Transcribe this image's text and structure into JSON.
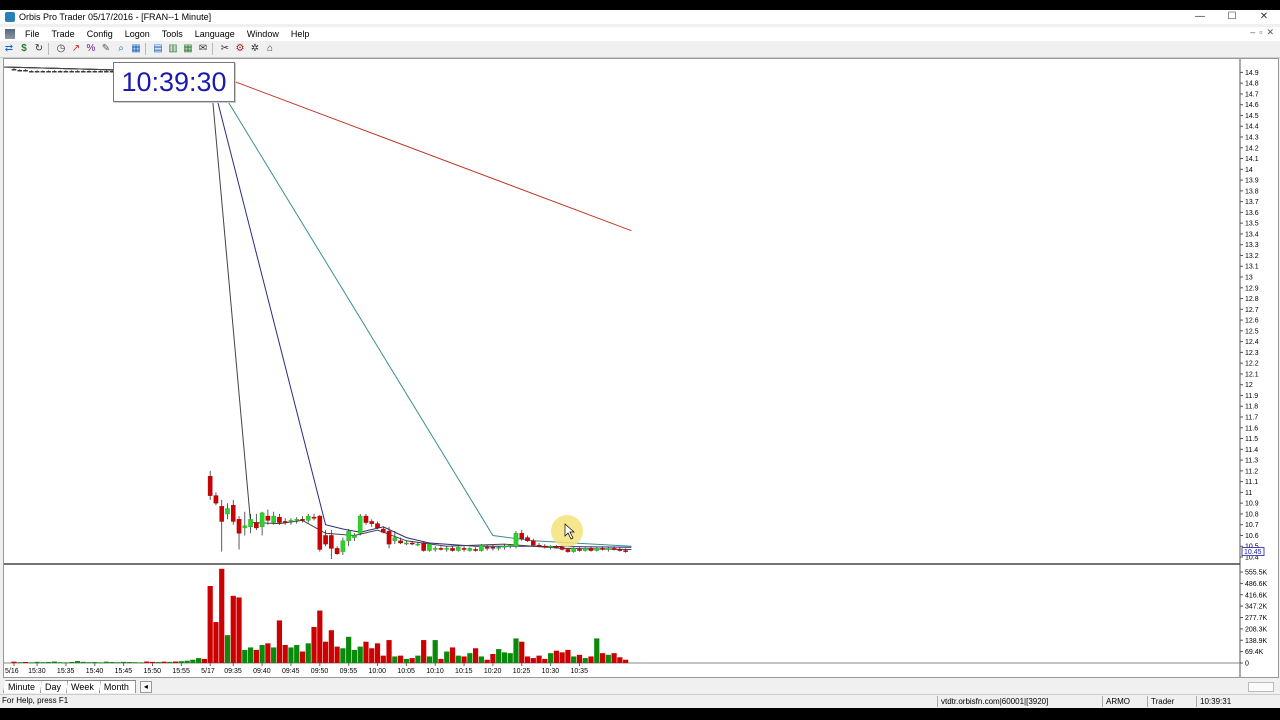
{
  "window": {
    "title": "Orbis Pro Trader  05/17/2016 - [FRAN--1 Minute]",
    "controls": [
      "—",
      "☐",
      "✕"
    ]
  },
  "menu": [
    "File",
    "Trade",
    "Config",
    "Logon",
    "Tools",
    "Language",
    "Window",
    "Help"
  ],
  "mdi_controls": [
    "–",
    "▫",
    "✕"
  ],
  "toolbar_icons": [
    "transfer-icon",
    "dollar-icon",
    "refresh-icon",
    "clock-icon",
    "draw-icon",
    "percent-icon",
    "pencil-icon",
    "zoom-icon",
    "grid-icon",
    "chart-icon",
    "chart-add-icon",
    "table-icon",
    "mail-icon",
    "tools-icon",
    "settings-icon",
    "gear-icon",
    "home-icon"
  ],
  "clock": "10:39:30",
  "tabs": [
    "Minute",
    "Day",
    "Week",
    "Month"
  ],
  "tab_nav": "◂",
  "status": {
    "help": "For Help, press F1",
    "server": "vtdtr.orbisfn.com|60001|[3920]",
    "account": "ARMO",
    "role": "Trader",
    "time": "10:39:31"
  },
  "colors": {
    "up": "#2ed12e",
    "down": "#cc0000",
    "vol_up": "#0a8a0a",
    "vol_down": "#cc0000",
    "ma_red": "#c0392b",
    "ma_teal": "#3a8f8f",
    "ma_navy": "#2b2b80",
    "ma_dark": "#444444",
    "clock_text": "#1a1ab0"
  },
  "chart_data": {
    "type": "candlestick",
    "symbol": "FRAN",
    "interval": "1 Minute",
    "price_ylim": [
      10.4,
      14.95
    ],
    "price_ticks": [
      "14.9",
      "14.8",
      "14.7",
      "14.6",
      "14.5",
      "14.4",
      "14.3",
      "14.2",
      "14.1",
      "14",
      "13.9",
      "13.8",
      "13.7",
      "13.6",
      "13.5",
      "13.4",
      "13.3",
      "13.2",
      "13.1",
      "13",
      "12.9",
      "12.8",
      "12.7",
      "12.6",
      "12.5",
      "12.4",
      "12.3",
      "12.2",
      "12.1",
      "12",
      "11.9",
      "11.8",
      "11.7",
      "11.6",
      "11.5",
      "11.4",
      "11.3",
      "11.2",
      "11.1",
      "11",
      "10.9",
      "10.8",
      "10.7",
      "10.6",
      "10.5",
      "10.4"
    ],
    "current_price_label": "10.45",
    "volume_ticks": [
      "555.5K",
      "486.6K",
      "416.6K",
      "347.2K",
      "277.7K",
      "208.3K",
      "138.9K",
      "69.4K",
      "0"
    ],
    "volume_ylim": [
      0,
      555500
    ],
    "x_labels": [
      {
        "t": 0,
        "label": "5/16"
      },
      {
        "t": 4,
        "label": "15:30"
      },
      {
        "t": 9,
        "label": "15:35"
      },
      {
        "t": 14,
        "label": "15:40"
      },
      {
        "t": 19,
        "label": "15:45"
      },
      {
        "t": 24,
        "label": "15:50"
      },
      {
        "t": 29,
        "label": "15:55"
      },
      {
        "t": 34,
        "label": "5/17"
      },
      {
        "t": 38,
        "label": "09:35"
      },
      {
        "t": 43,
        "label": "09:40"
      },
      {
        "t": 48,
        "label": "09:45"
      },
      {
        "t": 53,
        "label": "09:50"
      },
      {
        "t": 58,
        "label": "09:55"
      },
      {
        "t": 63,
        "label": "10:00"
      },
      {
        "t": 68,
        "label": "10:05"
      },
      {
        "t": 73,
        "label": "10:10"
      },
      {
        "t": 78,
        "label": "10:15"
      },
      {
        "t": 83,
        "label": "10:20"
      },
      {
        "t": 88,
        "label": "10:25"
      },
      {
        "t": 93,
        "label": "10:30"
      },
      {
        "t": 98,
        "label": "10:35"
      }
    ],
    "candles": [
      {
        "o": 14.93,
        "h": 14.94,
        "l": 14.92,
        "c": 14.92,
        "v": 8000
      },
      {
        "o": 14.92,
        "h": 14.93,
        "l": 14.91,
        "c": 14.92,
        "v": 5000
      },
      {
        "o": 14.92,
        "h": 14.93,
        "l": 14.91,
        "c": 14.91,
        "v": 6000
      },
      {
        "o": 14.91,
        "h": 14.92,
        "l": 14.9,
        "c": 14.91,
        "v": 4000
      },
      {
        "o": 14.91,
        "h": 14.92,
        "l": 14.9,
        "c": 14.91,
        "v": 7000
      },
      {
        "o": 14.91,
        "h": 14.92,
        "l": 14.9,
        "c": 14.91,
        "v": 5000
      },
      {
        "o": 14.91,
        "h": 14.92,
        "l": 14.9,
        "c": 14.91,
        "v": 6000
      },
      {
        "o": 14.91,
        "h": 14.92,
        "l": 14.9,
        "c": 14.91,
        "v": 9000
      },
      {
        "o": 14.91,
        "h": 14.92,
        "l": 14.9,
        "c": 14.91,
        "v": 5000
      },
      {
        "o": 14.91,
        "h": 14.92,
        "l": 14.9,
        "c": 14.91,
        "v": 4000
      },
      {
        "o": 14.91,
        "h": 14.92,
        "l": 14.9,
        "c": 14.91,
        "v": 6000
      },
      {
        "o": 14.91,
        "h": 14.92,
        "l": 14.9,
        "c": 14.91,
        "v": 12000
      },
      {
        "o": 14.91,
        "h": 14.92,
        "l": 14.9,
        "c": 14.91,
        "v": 7000
      },
      {
        "o": 14.91,
        "h": 14.92,
        "l": 14.9,
        "c": 14.91,
        "v": 5000
      },
      {
        "o": 14.91,
        "h": 14.92,
        "l": 14.9,
        "c": 14.91,
        "v": 6000
      },
      {
        "o": 14.91,
        "h": 14.92,
        "l": 14.9,
        "c": 14.91,
        "v": 4000
      },
      {
        "o": 14.91,
        "h": 14.92,
        "l": 14.9,
        "c": 14.91,
        "v": 8000
      },
      {
        "o": 14.91,
        "h": 14.92,
        "l": 14.9,
        "c": 14.91,
        "v": 6000
      },
      {
        "o": 14.91,
        "h": 14.92,
        "l": 14.9,
        "c": 14.91,
        "v": 5000
      },
      {
        "o": 14.91,
        "h": 14.92,
        "l": 14.9,
        "c": 14.91,
        "v": 7000
      },
      {
        "o": 14.91,
        "h": 14.92,
        "l": 14.9,
        "c": 14.91,
        "v": 6000
      },
      {
        "o": 14.91,
        "h": 14.92,
        "l": 14.9,
        "c": 14.91,
        "v": 5000
      },
      {
        "o": 14.91,
        "h": 14.92,
        "l": 14.9,
        "c": 14.91,
        "v": 4000
      },
      {
        "o": 14.92,
        "h": 14.93,
        "l": 14.9,
        "c": 14.91,
        "v": 9000
      },
      {
        "o": 14.91,
        "h": 14.92,
        "l": 14.89,
        "c": 14.9,
        "v": 7000
      },
      {
        "o": 14.9,
        "h": 14.91,
        "l": 14.89,
        "c": 14.9,
        "v": 6000
      },
      {
        "o": 14.91,
        "h": 14.92,
        "l": 14.89,
        "c": 14.9,
        "v": 8000
      },
      {
        "o": 14.9,
        "h": 14.91,
        "l": 14.89,
        "c": 14.91,
        "v": 7000
      },
      {
        "o": 14.91,
        "h": 14.92,
        "l": 14.9,
        "c": 14.9,
        "v": 9000
      },
      {
        "o": 14.9,
        "h": 14.91,
        "l": 14.89,
        "c": 14.9,
        "v": 11000
      },
      {
        "o": 14.9,
        "h": 14.91,
        "l": 14.89,
        "c": 14.9,
        "v": 14000
      },
      {
        "o": 14.9,
        "h": 14.91,
        "l": 14.89,
        "c": 14.9,
        "v": 20000
      },
      {
        "o": 14.9,
        "h": 14.91,
        "l": 14.89,
        "c": 14.9,
        "v": 30000
      },
      {
        "o": 14.91,
        "h": 14.92,
        "l": 14.89,
        "c": 14.9,
        "v": 25000
      },
      {
        "o": 11.15,
        "h": 11.2,
        "l": 10.93,
        "c": 10.97,
        "v": 470000
      },
      {
        "o": 10.97,
        "h": 11.0,
        "l": 10.88,
        "c": 10.9,
        "v": 250000
      },
      {
        "o": 10.87,
        "h": 10.93,
        "l": 10.45,
        "c": 10.73,
        "v": 575000
      },
      {
        "o": 10.8,
        "h": 10.9,
        "l": 10.75,
        "c": 10.85,
        "v": 170000
      },
      {
        "o": 10.88,
        "h": 10.93,
        "l": 10.7,
        "c": 10.73,
        "v": 410000
      },
      {
        "o": 10.75,
        "h": 10.78,
        "l": 10.47,
        "c": 10.62,
        "v": 400000
      },
      {
        "o": 10.67,
        "h": 10.82,
        "l": 10.6,
        "c": 10.69,
        "v": 80000
      },
      {
        "o": 10.68,
        "h": 10.8,
        "l": 10.62,
        "c": 10.75,
        "v": 95000
      },
      {
        "o": 10.72,
        "h": 10.8,
        "l": 10.65,
        "c": 10.67,
        "v": 80000
      },
      {
        "o": 10.68,
        "h": 10.82,
        "l": 10.6,
        "c": 10.81,
        "v": 110000
      },
      {
        "o": 10.78,
        "h": 10.84,
        "l": 10.7,
        "c": 10.74,
        "v": 120000
      },
      {
        "o": 10.72,
        "h": 10.82,
        "l": 10.7,
        "c": 10.78,
        "v": 95000
      },
      {
        "o": 10.77,
        "h": 10.8,
        "l": 10.7,
        "c": 10.72,
        "v": 260000
      },
      {
        "o": 10.73,
        "h": 10.76,
        "l": 10.7,
        "c": 10.72,
        "v": 110000
      },
      {
        "o": 10.73,
        "h": 10.76,
        "l": 10.7,
        "c": 10.74,
        "v": 95000
      },
      {
        "o": 10.74,
        "h": 10.77,
        "l": 10.71,
        "c": 10.75,
        "v": 110000
      },
      {
        "o": 10.75,
        "h": 10.78,
        "l": 10.72,
        "c": 10.74,
        "v": 70000
      },
      {
        "o": 10.74,
        "h": 10.8,
        "l": 10.72,
        "c": 10.78,
        "v": 120000
      },
      {
        "o": 10.77,
        "h": 10.8,
        "l": 10.74,
        "c": 10.76,
        "v": 220000
      },
      {
        "o": 10.78,
        "h": 10.79,
        "l": 10.45,
        "c": 10.47,
        "v": 320000
      },
      {
        "o": 10.6,
        "h": 10.65,
        "l": 10.5,
        "c": 10.52,
        "v": 130000
      },
      {
        "o": 10.6,
        "h": 10.65,
        "l": 10.38,
        "c": 10.48,
        "v": 200000
      },
      {
        "o": 10.48,
        "h": 10.5,
        "l": 10.42,
        "c": 10.43,
        "v": 100000
      },
      {
        "o": 10.45,
        "h": 10.58,
        "l": 10.42,
        "c": 10.55,
        "v": 90000
      },
      {
        "o": 10.55,
        "h": 10.66,
        "l": 10.5,
        "c": 10.64,
        "v": 160000
      },
      {
        "o": 10.58,
        "h": 10.62,
        "l": 10.55,
        "c": 10.6,
        "v": 80000
      },
      {
        "o": 10.62,
        "h": 10.8,
        "l": 10.6,
        "c": 10.78,
        "v": 100000
      },
      {
        "o": 10.78,
        "h": 10.8,
        "l": 10.7,
        "c": 10.72,
        "v": 130000
      },
      {
        "o": 10.73,
        "h": 10.75,
        "l": 10.68,
        "c": 10.71,
        "v": 90000
      },
      {
        "o": 10.71,
        "h": 10.73,
        "l": 10.66,
        "c": 10.67,
        "v": 120000
      },
      {
        "o": 10.66,
        "h": 10.68,
        "l": 10.62,
        "c": 10.63,
        "v": 45000
      },
      {
        "o": 10.64,
        "h": 10.68,
        "l": 10.48,
        "c": 10.52,
        "v": 140000
      },
      {
        "o": 10.55,
        "h": 10.64,
        "l": 10.52,
        "c": 10.58,
        "v": 40000
      },
      {
        "o": 10.55,
        "h": 10.58,
        "l": 10.52,
        "c": 10.53,
        "v": 45000
      },
      {
        "o": 10.53,
        "h": 10.55,
        "l": 10.51,
        "c": 10.53,
        "v": 25000
      },
      {
        "o": 10.53,
        "h": 10.55,
        "l": 10.51,
        "c": 10.52,
        "v": 30000
      },
      {
        "o": 10.52,
        "h": 10.54,
        "l": 10.5,
        "c": 10.52,
        "v": 45000
      },
      {
        "o": 10.53,
        "h": 10.54,
        "l": 10.45,
        "c": 10.46,
        "v": 140000
      },
      {
        "o": 10.46,
        "h": 10.53,
        "l": 10.45,
        "c": 10.52,
        "v": 40000
      },
      {
        "o": 10.47,
        "h": 10.5,
        "l": 10.45,
        "c": 10.48,
        "v": 140000
      },
      {
        "o": 10.48,
        "h": 10.5,
        "l": 10.46,
        "c": 10.47,
        "v": 25000
      },
      {
        "o": 10.47,
        "h": 10.5,
        "l": 10.45,
        "c": 10.48,
        "v": 70000
      },
      {
        "o": 10.48,
        "h": 10.5,
        "l": 10.45,
        "c": 10.46,
        "v": 95000
      },
      {
        "o": 10.46,
        "h": 10.5,
        "l": 10.45,
        "c": 10.49,
        "v": 45000
      },
      {
        "o": 10.48,
        "h": 10.5,
        "l": 10.45,
        "c": 10.47,
        "v": 40000
      },
      {
        "o": 10.46,
        "h": 10.49,
        "l": 10.45,
        "c": 10.48,
        "v": 60000
      },
      {
        "o": 10.47,
        "h": 10.49,
        "l": 10.45,
        "c": 10.46,
        "v": 90000
      },
      {
        "o": 10.46,
        "h": 10.52,
        "l": 10.45,
        "c": 10.51,
        "v": 40000
      },
      {
        "o": 10.49,
        "h": 10.51,
        "l": 10.46,
        "c": 10.48,
        "v": 20000
      },
      {
        "o": 10.49,
        "h": 10.51,
        "l": 10.46,
        "c": 10.48,
        "v": 55000
      },
      {
        "o": 10.48,
        "h": 10.5,
        "l": 10.46,
        "c": 10.49,
        "v": 85000
      },
      {
        "o": 10.49,
        "h": 10.52,
        "l": 10.47,
        "c": 10.5,
        "v": 65000
      },
      {
        "o": 10.5,
        "h": 10.52,
        "l": 10.48,
        "c": 10.51,
        "v": 60000
      },
      {
        "o": 10.5,
        "h": 10.64,
        "l": 10.48,
        "c": 10.62,
        "v": 150000
      },
      {
        "o": 10.62,
        "h": 10.65,
        "l": 10.55,
        "c": 10.57,
        "v": 130000
      },
      {
        "o": 10.58,
        "h": 10.6,
        "l": 10.54,
        "c": 10.55,
        "v": 40000
      },
      {
        "o": 10.55,
        "h": 10.57,
        "l": 10.5,
        "c": 10.51,
        "v": 30000
      },
      {
        "o": 10.51,
        "h": 10.53,
        "l": 10.49,
        "c": 10.5,
        "v": 45000
      },
      {
        "o": 10.5,
        "h": 10.52,
        "l": 10.48,
        "c": 10.49,
        "v": 25000
      },
      {
        "o": 10.49,
        "h": 10.51,
        "l": 10.47,
        "c": 10.5,
        "v": 60000
      },
      {
        "o": 10.5,
        "h": 10.51,
        "l": 10.48,
        "c": 10.49,
        "v": 75000
      },
      {
        "o": 10.49,
        "h": 10.5,
        "l": 10.46,
        "c": 10.47,
        "v": 65000
      },
      {
        "o": 10.47,
        "h": 10.48,
        "l": 10.44,
        "c": 10.45,
        "v": 80000
      },
      {
        "o": 10.45,
        "h": 10.49,
        "l": 10.44,
        "c": 10.48,
        "v": 40000
      },
      {
        "o": 10.47,
        "h": 10.49,
        "l": 10.45,
        "c": 10.46,
        "v": 50000
      },
      {
        "o": 10.46,
        "h": 10.49,
        "l": 10.45,
        "c": 10.48,
        "v": 30000
      },
      {
        "o": 10.48,
        "h": 10.5,
        "l": 10.45,
        "c": 10.46,
        "v": 40000
      },
      {
        "o": 10.46,
        "h": 10.49,
        "l": 10.45,
        "c": 10.48,
        "v": 150000
      },
      {
        "o": 10.48,
        "h": 10.5,
        "l": 10.46,
        "c": 10.47,
        "v": 60000
      },
      {
        "o": 10.47,
        "h": 10.49,
        "l": 10.45,
        "c": 10.48,
        "v": 50000
      },
      {
        "o": 10.48,
        "h": 10.5,
        "l": 10.46,
        "c": 10.47,
        "v": 60000
      },
      {
        "o": 10.47,
        "h": 10.49,
        "l": 10.45,
        "c": 10.46,
        "v": 35000
      },
      {
        "o": 10.46,
        "h": 10.48,
        "l": 10.44,
        "c": 10.45,
        "v": 20000
      }
    ],
    "moving_averages": [
      {
        "color_key": "ma_red",
        "points": [
          [
            -2,
            14.95
          ],
          [
            34,
            14.9
          ],
          [
            107,
            13.43
          ]
        ]
      },
      {
        "color_key": "ma_teal",
        "points": [
          [
            -2,
            14.95
          ],
          [
            34,
            14.9
          ],
          [
            83,
            10.6
          ],
          [
            90,
            10.55
          ],
          [
            107,
            10.5
          ]
        ]
      },
      {
        "color_key": "ma_navy",
        "points": [
          [
            -2,
            14.95
          ],
          [
            34,
            14.9
          ],
          [
            54,
            10.7
          ],
          [
            57,
            10.66
          ],
          [
            60,
            10.63
          ],
          [
            64,
            10.68
          ],
          [
            68,
            10.58
          ],
          [
            72,
            10.53
          ],
          [
            80,
            10.5
          ],
          [
            90,
            10.5
          ],
          [
            107,
            10.49
          ]
        ]
      },
      {
        "color_key": "ma_dark",
        "points": [
          [
            -2,
            14.95
          ],
          [
            34,
            14.9
          ],
          [
            41,
            10.72
          ],
          [
            46,
            10.71
          ],
          [
            50,
            10.74
          ],
          [
            54,
            10.62
          ],
          [
            59,
            10.6
          ],
          [
            63,
            10.65
          ],
          [
            68,
            10.55
          ],
          [
            75,
            10.5
          ],
          [
            85,
            10.52
          ],
          [
            95,
            10.48
          ],
          [
            107,
            10.47
          ]
        ]
      }
    ]
  }
}
